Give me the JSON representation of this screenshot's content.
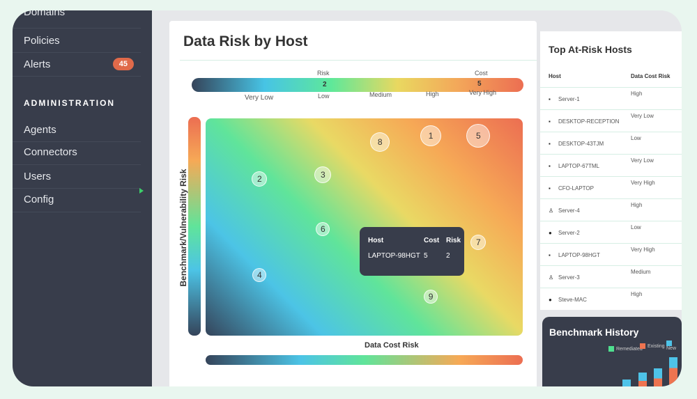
{
  "sidebar": {
    "items": [
      {
        "label": "Domains"
      },
      {
        "label": "Policies"
      },
      {
        "label": "Alerts",
        "badge": "45"
      }
    ],
    "section": "ADMINISTRATION",
    "admin_items": [
      {
        "label": "Agents"
      },
      {
        "label": "Connectors"
      },
      {
        "label": "Users"
      },
      {
        "label": "Config"
      }
    ]
  },
  "heatmap": {
    "title": "Data Risk by Host",
    "legend": {
      "risk_label": "Risk",
      "cost_label": "Cost",
      "risk_value": "2",
      "cost_value": "5",
      "levels": [
        "Very Low",
        "Low",
        "Medium",
        "High",
        "Very High"
      ]
    },
    "ylabel": "Benchmark/Vulnerability Risk",
    "xlabel": "Data Cost Risk",
    "bubbles": [
      "1",
      "2",
      "3",
      "4",
      "5",
      "6",
      "7",
      "8",
      "9"
    ],
    "tooltip": {
      "host_label": "Host",
      "cost_label": "Cost",
      "risk_label": "Risk",
      "host": "LAPTOP-98HGT",
      "cost": "5",
      "risk": "2"
    }
  },
  "hosts": {
    "title": "Top At-Risk Hosts",
    "col_host": "Host",
    "col_risk": "Data Cost Risk",
    "rows": [
      {
        "os": "windows",
        "host": "Server-1",
        "risk": "High"
      },
      {
        "os": "windows",
        "host": "DESKTOP-RECEPTION",
        "risk": "Very Low"
      },
      {
        "os": "windows",
        "host": "DESKTOP-43TJM",
        "risk": "Low"
      },
      {
        "os": "windows",
        "host": "LAPTOP-67TML",
        "risk": "Very Low"
      },
      {
        "os": "windows",
        "host": "CFO-LAPTOP",
        "risk": "Very High"
      },
      {
        "os": "linux",
        "host": "Server-4",
        "risk": "High"
      },
      {
        "os": "apple",
        "host": "Server-2",
        "risk": "Low"
      },
      {
        "os": "windows",
        "host": "LAPTOP-98HGT",
        "risk": "Very High"
      },
      {
        "os": "linux",
        "host": "Server-3",
        "risk": "Medium"
      },
      {
        "os": "apple",
        "host": "Steve-MAC",
        "risk": "High"
      }
    ]
  },
  "benchmark": {
    "title": "Benchmark History",
    "legend": [
      "Remediated",
      "Existing",
      "New"
    ],
    "colors": {
      "remediated": "#4fe08f",
      "existing": "#ee7450",
      "new": "#4ec3e8"
    }
  },
  "colors": {
    "sidebar": "#383d4b",
    "accent": "#e06a4a",
    "background": "#e9f6ef"
  }
}
